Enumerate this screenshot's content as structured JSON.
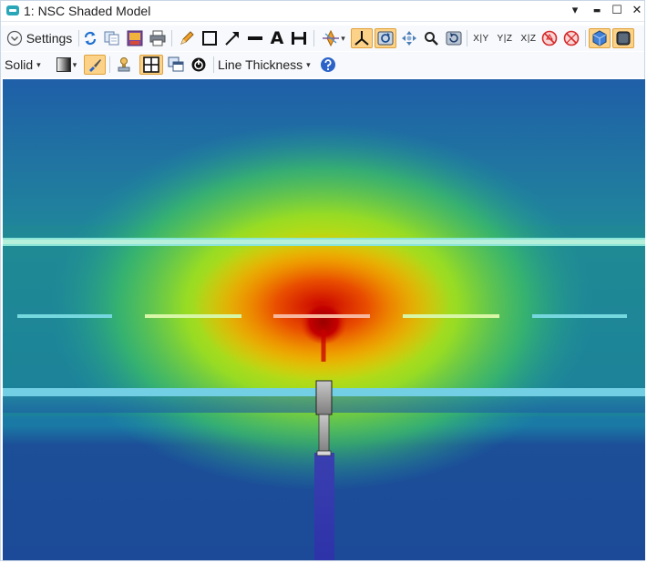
{
  "window": {
    "title": "1: NSC Shaded Model",
    "controls": {
      "menu": "▾",
      "minimize": "▬",
      "maximize": "☐",
      "close": "✕"
    }
  },
  "toolbar1": {
    "settings_label": "Settings",
    "axis_labels": {
      "xy": "X|Y",
      "yz": "Y|Z",
      "xz": "X|Z"
    },
    "text_tool_glyph": "A"
  },
  "toolbar2": {
    "solid_label": "Solid",
    "line_thickness_label": "Line Thickness"
  },
  "colors": {
    "active_button": "#fbd287",
    "active_border": "#e0a23c",
    "teal_icon": "#29a7b8"
  }
}
